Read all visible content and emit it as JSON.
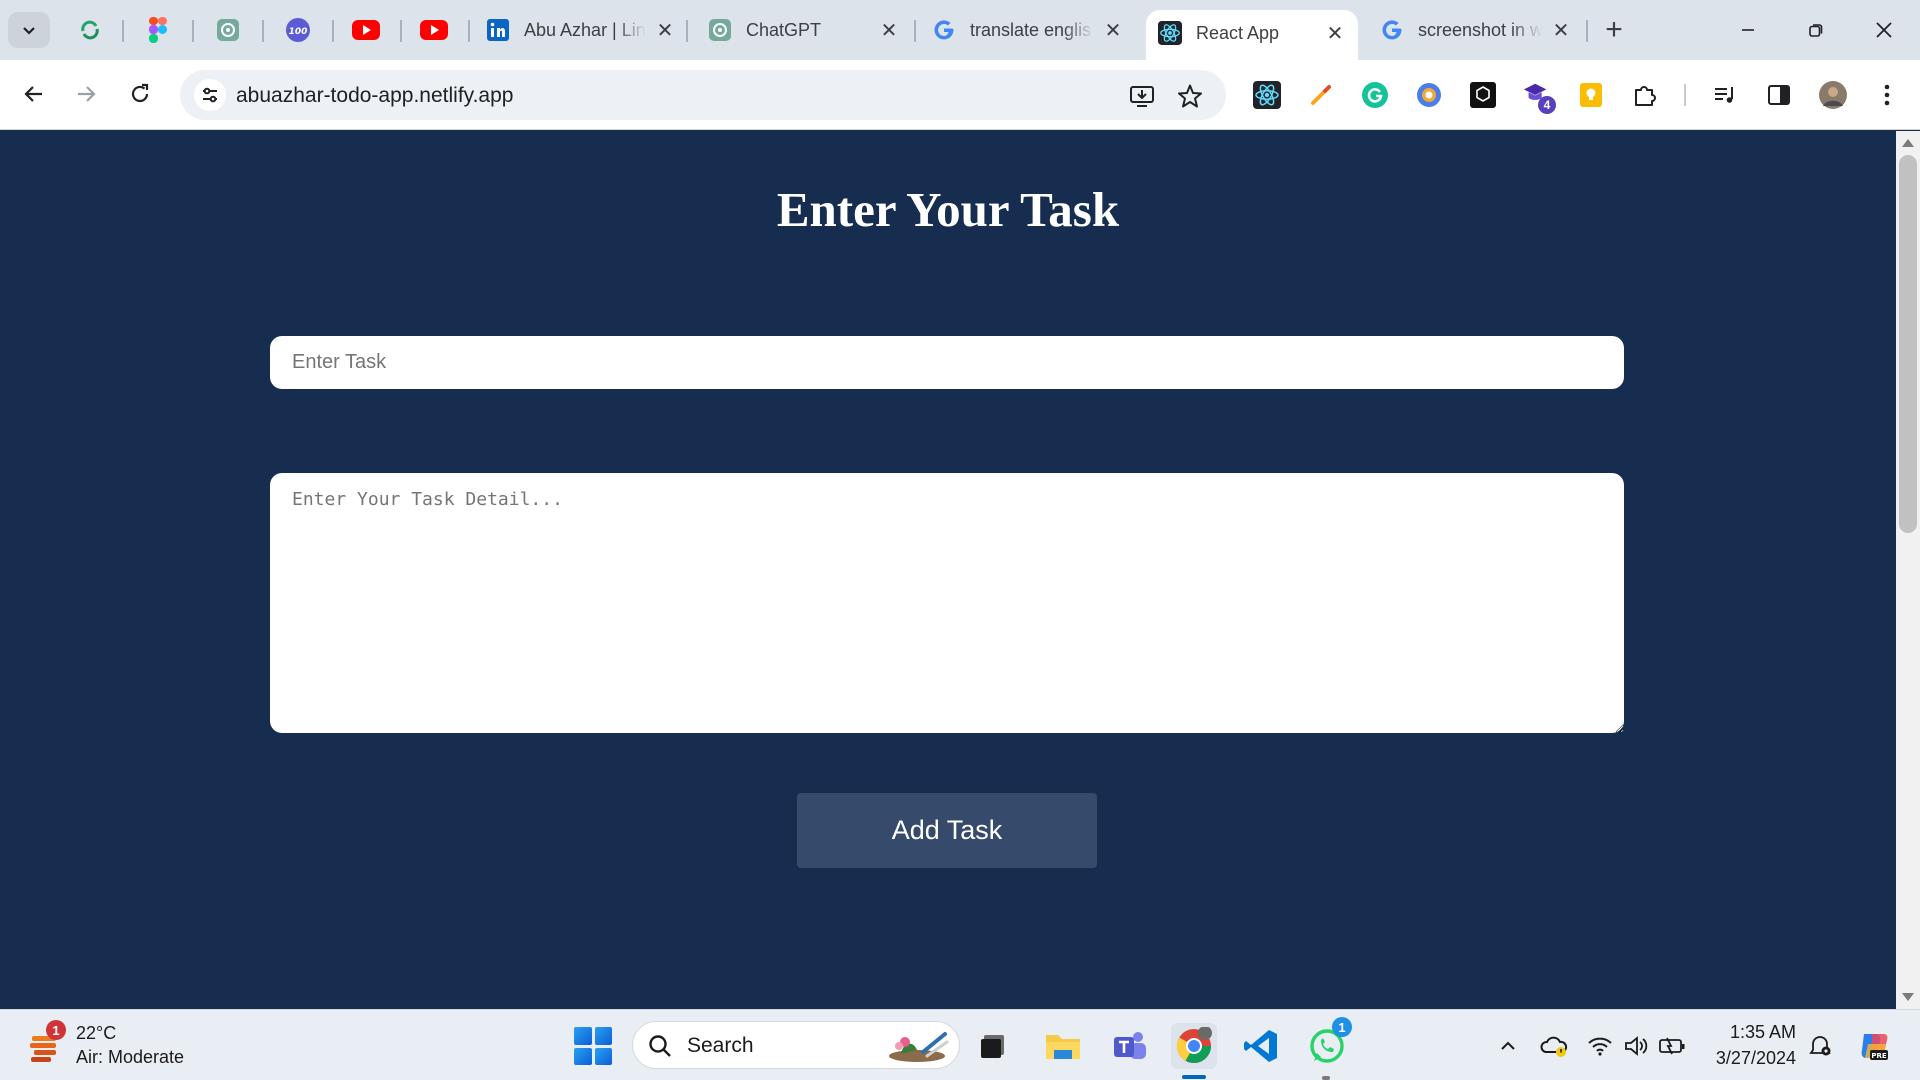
{
  "browser": {
    "pinned_tabs": [
      {
        "icon": "refresh-app-icon"
      },
      {
        "icon": "figma-icon"
      },
      {
        "icon": "chatgpt-icon"
      },
      {
        "icon": "100-icon",
        "text": "100"
      },
      {
        "icon": "youtube-icon"
      },
      {
        "icon": "youtube-icon"
      }
    ],
    "tabs": [
      {
        "title": "Abu Azhar | Lin",
        "icon": "linkedin-icon",
        "active": false
      },
      {
        "title": "ChatGPT",
        "icon": "chatgpt-icon",
        "active": false
      },
      {
        "title": "translate englis",
        "icon": "google-icon",
        "active": false
      },
      {
        "title": "React App",
        "icon": "react-icon",
        "active": true
      },
      {
        "title": "screenshot in w",
        "icon": "google-icon",
        "active": false
      }
    ],
    "close_glyph": "✕",
    "new_tab_glyph": "+",
    "url": "abuazhar-todo-app.netlify.app",
    "extension_badge": "4"
  },
  "page": {
    "title": "Enter Your Task",
    "task_input": {
      "placeholder": "Enter Task",
      "value": ""
    },
    "task_detail": {
      "placeholder": "Enter Your Task Detail...",
      "value": ""
    },
    "add_button": "Add Task",
    "background": "#172d4f",
    "button_color": "#364b6c"
  },
  "taskbar": {
    "weather": {
      "temperature": "22°C",
      "description": "Air: Moderate",
      "badge": "1"
    },
    "search_label": "Search",
    "whatsapp_badge": "1",
    "clock": {
      "time": "1:35 AM",
      "date": "3/27/2024"
    }
  }
}
